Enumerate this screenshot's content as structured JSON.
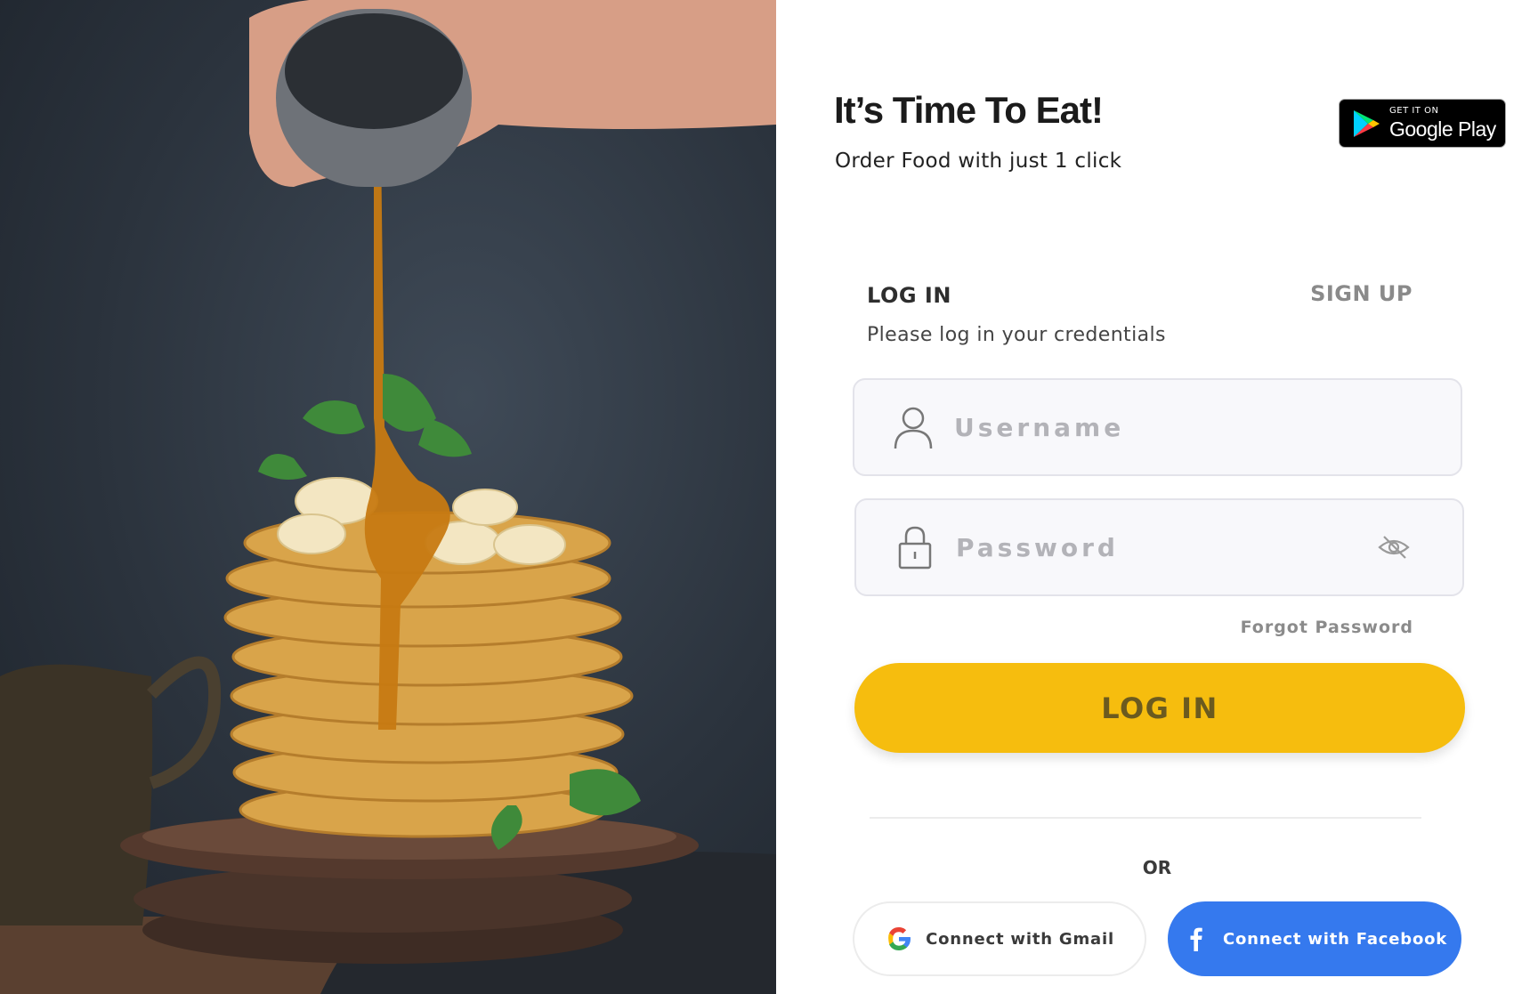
{
  "hero": {
    "image_alt": "pancakes-with-syrup-photo"
  },
  "header": {
    "title": "It’s Time To Eat!",
    "subtitle": "Order Food with just 1 click"
  },
  "store_badge": {
    "small": "GET IT ON",
    "big": "Google Play",
    "icon": "play-triangle-icon"
  },
  "tabs": {
    "login": "LOG IN",
    "signup": "SIGN UP"
  },
  "form": {
    "hint": "Please log in your credentials",
    "username": {
      "value": "",
      "placeholder": "Username",
      "icon": "user-icon"
    },
    "password": {
      "value": "",
      "placeholder": "Password",
      "icon": "lock-icon",
      "toggle_icon": "eye-off-icon"
    },
    "forgot": "Forgot Password",
    "submit": "LOG IN"
  },
  "divider_label": "OR",
  "social": {
    "gmail": "Connect with Gmail",
    "facebook": "Connect with Facebook"
  },
  "colors": {
    "accent": "#f6bd0e",
    "facebook": "#3579ee",
    "field_bg": "#f8f8fb"
  }
}
